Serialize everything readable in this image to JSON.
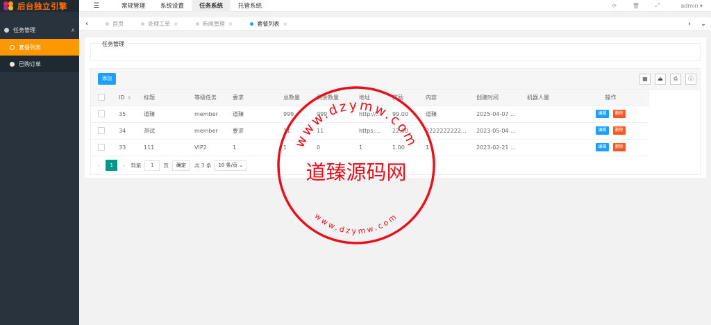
{
  "app": {
    "logo_text": "后台独立引擎"
  },
  "sidebar": {
    "group": {
      "label": "任务管理",
      "icon": "gear-icon"
    },
    "items": [
      {
        "label": "套餐列表",
        "icon": "refresh-ring-icon",
        "active": true
      },
      {
        "label": "已购订单",
        "icon": "gear-icon",
        "active": false
      }
    ]
  },
  "header": {
    "nav": [
      {
        "label": "常规管理"
      },
      {
        "label": "系统设置"
      },
      {
        "label": "任务系统",
        "active": true
      },
      {
        "label": "托管系统"
      }
    ],
    "user": "admin"
  },
  "tabs": [
    {
      "label": "首页",
      "closable": false
    },
    {
      "label": "处理工单",
      "closable": true
    },
    {
      "label": "新闻管理",
      "closable": true
    },
    {
      "label": "套餐列表",
      "closable": true,
      "active": true
    }
  ],
  "form": {
    "legend": "任务管理"
  },
  "toolbar": {
    "add_label": "添加"
  },
  "table": {
    "columns": [
      "ID",
      "标题",
      "等级任务",
      "要求",
      "总数量",
      "剩余数量",
      "地址",
      "奖励",
      "内容",
      "创建时间",
      "机器人量",
      "操作"
    ],
    "rows": [
      {
        "id": "35",
        "title": "道臻",
        "level": "member",
        "req": "道臻",
        "total": "999",
        "remain": "999",
        "url": "http://...",
        "reward": "99.00",
        "content": "道臻",
        "created": "2025-04-07 ...",
        "robots": ""
      },
      {
        "id": "34",
        "title": "测试",
        "level": "member",
        "req": "要求",
        "total": "11",
        "remain": "11",
        "url": "https:...",
        "reward": "22.00",
        "content": "22222222222...",
        "created": "2023-05-04 ...",
        "robots": ""
      },
      {
        "id": "33",
        "title": "111",
        "level": "VIP2",
        "req": "1",
        "total": "1",
        "remain": "0",
        "url": "1",
        "reward": "1.00",
        "content": "1",
        "created": "2023-02-21 ...",
        "robots": ""
      }
    ],
    "edit_label": "编辑",
    "delete_label": "删除"
  },
  "pager": {
    "current": "1",
    "goto_label": "到第",
    "page_input": "1",
    "page_unit": "页",
    "confirm_label": "确定",
    "total_text": "共 3 条",
    "page_size": "10 条/页"
  },
  "watermark": {
    "center_text": "道臻源码网",
    "ring_text_top": "www.dzymw.com",
    "ring_text_bottom": "www.dzymw.com",
    "color": "#e8101a"
  }
}
